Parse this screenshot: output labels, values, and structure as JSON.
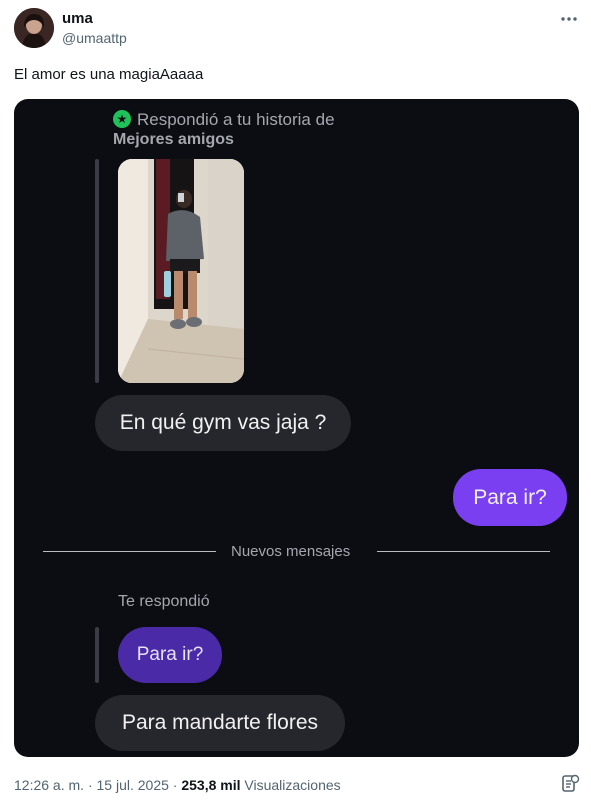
{
  "tweet": {
    "display_name": "uma",
    "handle": "@umaattp",
    "text": "El amor es una magiaAaaaa",
    "more_icon": "more-horizontal-icon"
  },
  "dm": {
    "story_reply": "Respondió a tu historia de",
    "story_audience": "Mejores amigos",
    "message_1": "En qué gym vas jaja ?",
    "message_2": "Para ir?",
    "divider": "Nuevos mensajes",
    "replied_label": "Te respondió",
    "quoted_message": "Para ir?",
    "message_3": "Para mandarte flores",
    "colors": {
      "background": "#0b0d12",
      "received_bubble": "#26272c",
      "sent_bubble": "#7b3ff2",
      "quoted_bubble": "#4b2aa8",
      "close_friends_badge": "#1fc15a"
    }
  },
  "footer": {
    "time": "12:26 a. m.",
    "date": "15 jul. 2025",
    "views_count": "253,8 mil",
    "views_label": "Visualizaciones"
  }
}
